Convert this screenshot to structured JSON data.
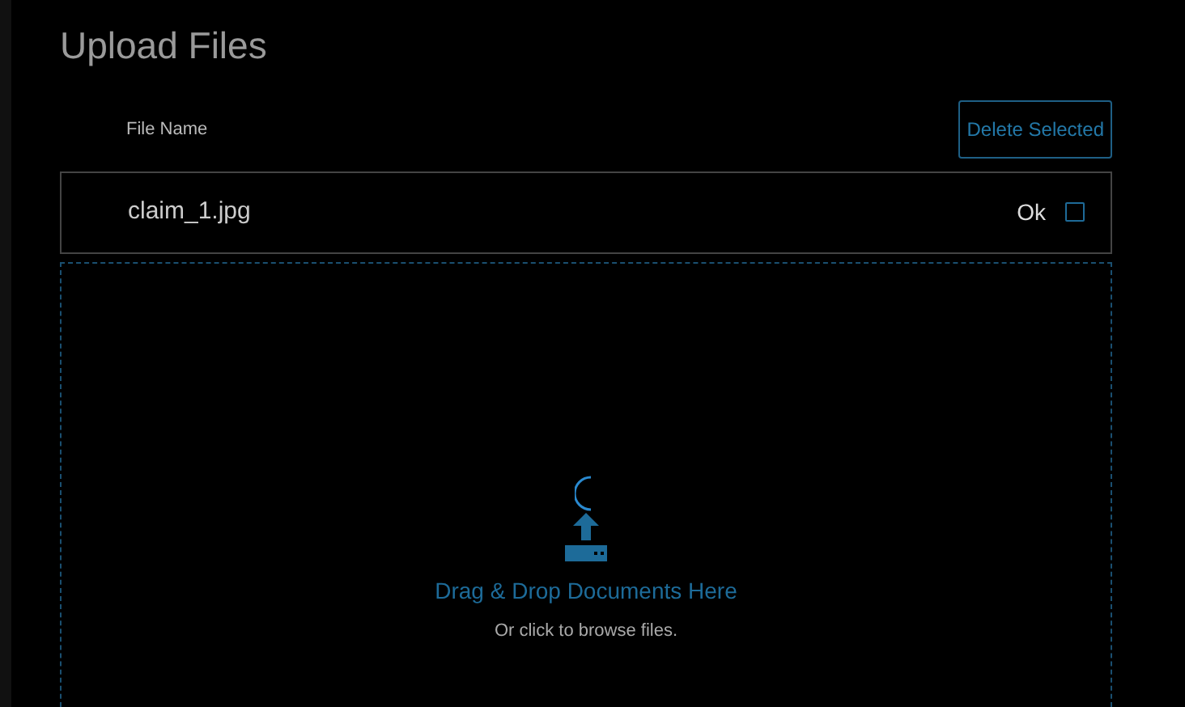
{
  "title": "Upload Files",
  "header": {
    "column_label": "File Name",
    "delete_button": "Delete Selected"
  },
  "files": [
    {
      "name": "claim_1.jpg",
      "status": "Ok",
      "checked": false
    }
  ],
  "dropzone": {
    "loading": true,
    "heading": "Drag & Drop Documents Here",
    "hint": "Or click to browse files."
  }
}
